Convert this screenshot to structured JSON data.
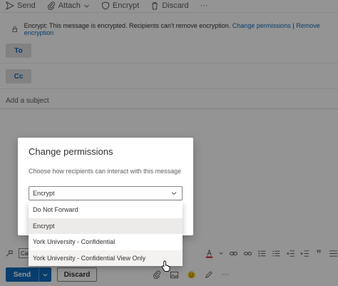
{
  "toolbar": {
    "send_label": "Send",
    "attach_label": "Attach",
    "encrypt_label": "Encrypt",
    "discard_label": "Discard",
    "more_label": "···"
  },
  "encryption_bar": {
    "message": "Encrypt: This message is encrypted. Recipients can't remove encryption.",
    "change_link": "Change permissions",
    "separator": "|",
    "remove_link": "Remove encryption"
  },
  "recipients": {
    "to_label": "To",
    "cc_label": "Cc"
  },
  "subject": {
    "placeholder": "Add a subject"
  },
  "dialog": {
    "title": "Change permissions",
    "description": "Choose how recipients can interact with this message",
    "selected_value": "Encrypt",
    "options": [
      {
        "label": "Do Not Forward"
      },
      {
        "label": "Encrypt"
      },
      {
        "label": "York University - Confidential"
      },
      {
        "label": "York University - Confidential View Only"
      }
    ]
  },
  "format_bar": {
    "font_name": "Cali",
    "quote_icon_label": "”"
  },
  "action_bar": {
    "send_label": "Send",
    "discard_label": "Discard",
    "more_label": "···"
  },
  "colors": {
    "accent": "#0f6cbd",
    "overlay": "rgba(0,0,0,0.42)"
  }
}
